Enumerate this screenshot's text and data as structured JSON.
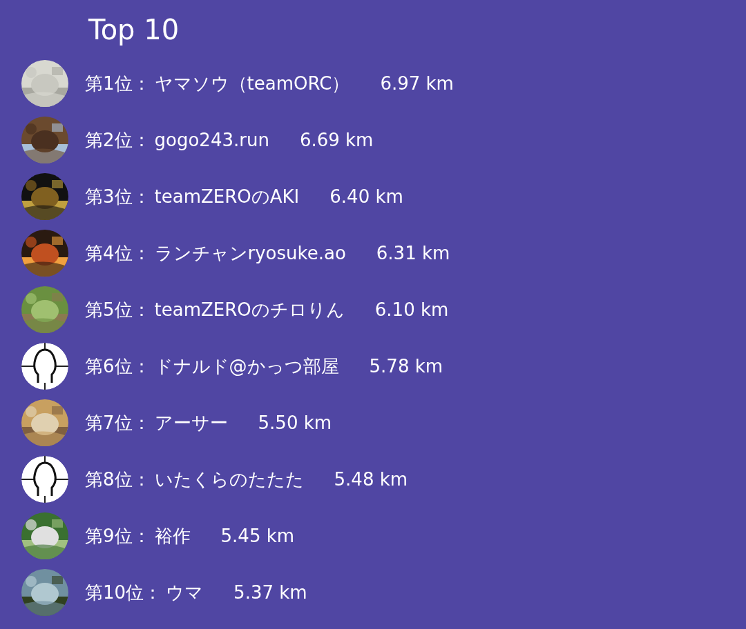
{
  "title": "Top 10",
  "ranking": [
    {
      "rank": "第1位：",
      "name": "ヤマソウ（teamORC）",
      "distance": "6.97 km"
    },
    {
      "rank": "第2位：",
      "name": "gogo243.run",
      "distance": "6.69 km"
    },
    {
      "rank": "第3位：",
      "name": "teamZEROのAKI",
      "distance": "6.40 km"
    },
    {
      "rank": "第4位：",
      "name": "ランチャンryosuke.ao",
      "distance": "6.31 km"
    },
    {
      "rank": "第5位：",
      "name": "teamZEROのチロりん",
      "distance": "6.10 km"
    },
    {
      "rank": "第6位：",
      "name": "ドナルド@かっつ部屋",
      "distance": "5.78 km",
      "avatar": {
        "kind": "default"
      }
    },
    {
      "rank": "第7位：",
      "name": "アーサー",
      "distance": "5.50 km"
    },
    {
      "rank": "第8位：",
      "name": "いたくらのたたた",
      "distance": "5.48 km",
      "avatar": {
        "kind": "default"
      }
    },
    {
      "rank": "第9位：",
      "name": "裕作",
      "distance": "5.45 km"
    },
    {
      "rank": "第10位：",
      "name": "ウマ",
      "distance": "5.37 km"
    }
  ]
}
